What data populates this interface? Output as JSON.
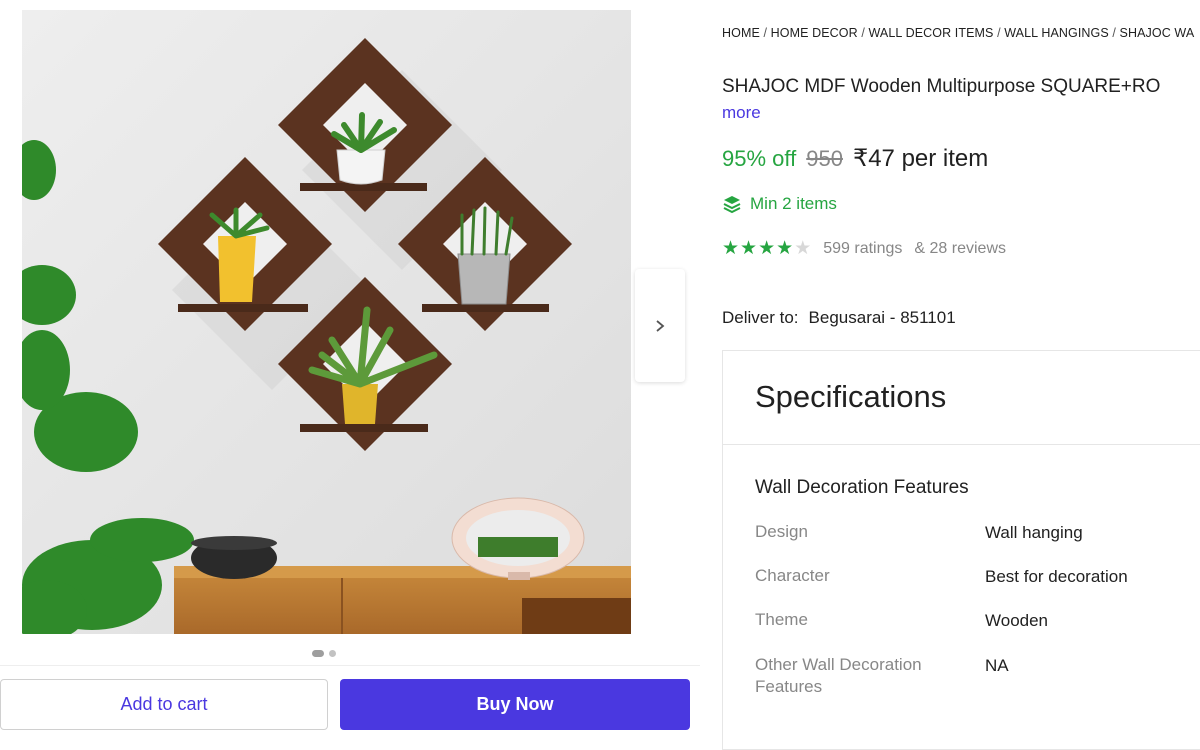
{
  "breadcrumb": [
    "HOME",
    "HOME DECOR",
    "WALL DECOR ITEMS",
    "WALL HANGINGS",
    "SHAJOC WA"
  ],
  "product": {
    "title": "SHAJOC MDF Wooden Multipurpose SQUARE+RO",
    "more_label": "more",
    "discount": "95% off",
    "mrp": "950",
    "price": "₹47 per item",
    "min_items": "Min 2 items",
    "rating_stars": 4,
    "ratings_text": "599 ratings",
    "reviews_text": "& 28 reviews"
  },
  "delivery": {
    "label": "Deliver to:",
    "location": "Begusarai - 851101"
  },
  "specifications": {
    "title": "Specifications",
    "section_title": "Wall Decoration Features",
    "rows": [
      {
        "key": "Design",
        "value": "Wall hanging"
      },
      {
        "key": "Character",
        "value": "Best for decoration"
      },
      {
        "key": "Theme",
        "value": "Wooden"
      },
      {
        "key": "Other Wall Decoration Features",
        "value": "NA"
      }
    ]
  },
  "gallery": {
    "image_count": 2,
    "active_index": 0
  },
  "actions": {
    "add_to_cart": "Add to cart",
    "buy_now": "Buy Now"
  },
  "colors": {
    "accent": "#4a38e0",
    "success": "#26a541",
    "muted": "#878787"
  },
  "icons": {
    "next": "chevron-right-icon",
    "min_items": "layers-icon",
    "rating": "star-icon"
  }
}
